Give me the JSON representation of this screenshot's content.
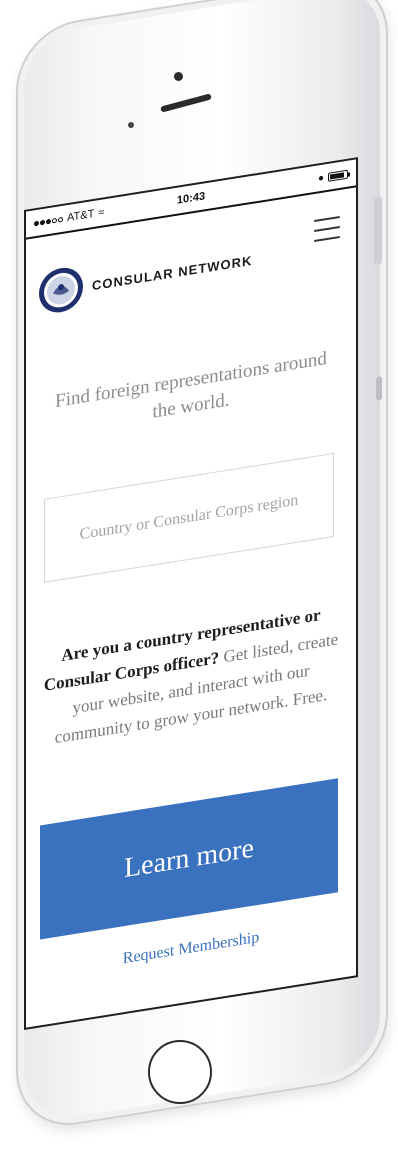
{
  "status_bar": {
    "carrier": "AT&T",
    "time": "10:43"
  },
  "header": {
    "brand": "CONSULAR NETWORK"
  },
  "main": {
    "tagline": "Find foreign representations around the world.",
    "search": {
      "placeholder": "Country or Consular Corps region",
      "value": ""
    },
    "pitch_strong": "Are you a country representative or Consular Corps officer?",
    "pitch_rest": " Get listed, create your website, and interact with our community to grow your network. Free.",
    "cta_label": "Learn more",
    "request_link": "Request Membership"
  },
  "colors": {
    "accent": "#3b72c0",
    "text_dark": "#1d1d1f",
    "text_muted": "#8c8c8f",
    "logo_navy": "#1f2f6e"
  },
  "icons": {
    "menu": "hamburger-icon",
    "wifi": "wifi-icon",
    "battery": "battery-icon",
    "logo": "seal-logo"
  },
  "battery_level": 0.9
}
